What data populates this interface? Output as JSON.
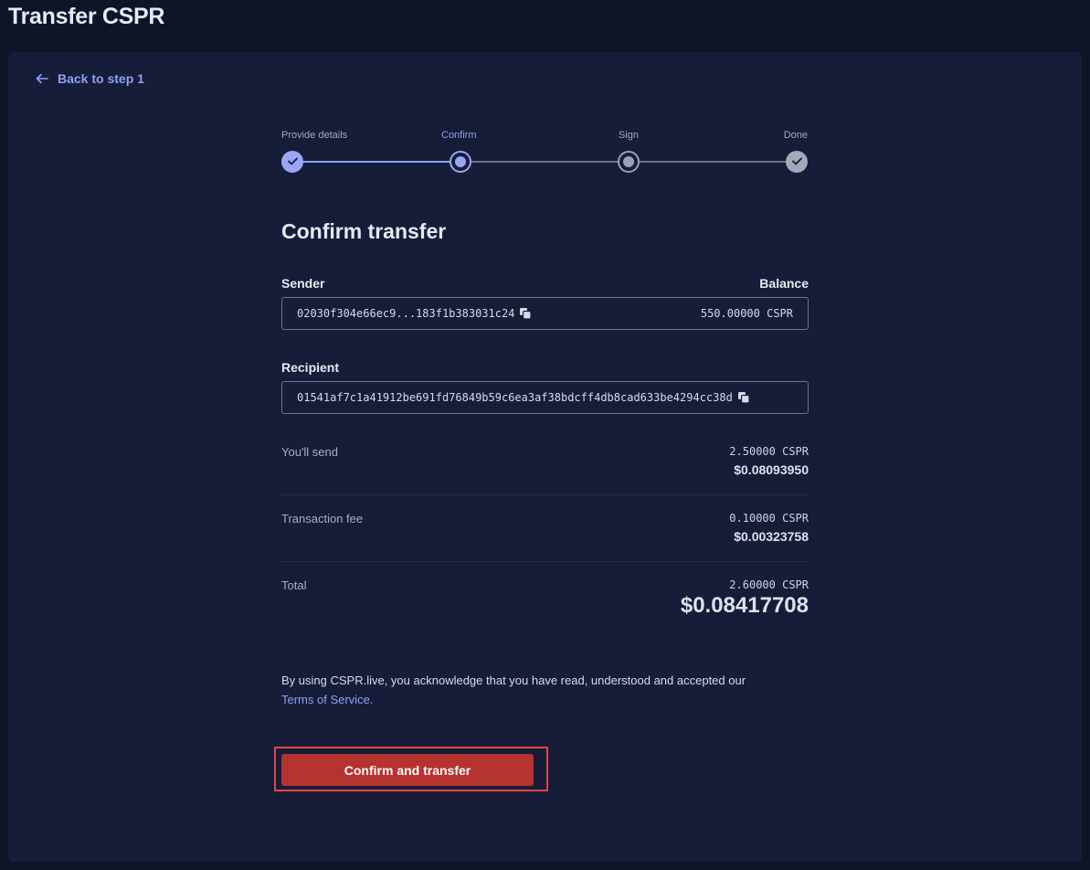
{
  "page": {
    "title": "Transfer CSPR"
  },
  "nav": {
    "back_label": "Back to step 1"
  },
  "stepper": {
    "steps": [
      {
        "label": "Provide details",
        "state": "done"
      },
      {
        "label": "Confirm",
        "state": "active"
      },
      {
        "label": "Sign",
        "state": "pending"
      },
      {
        "label": "Done",
        "state": "pending"
      }
    ]
  },
  "confirm": {
    "heading": "Confirm transfer",
    "sender_label": "Sender",
    "balance_label": "Balance",
    "sender_address": "02030f304e66ec9...183f1b383031c24",
    "balance_value": "550.00000 CSPR",
    "recipient_label": "Recipient",
    "recipient_address": "01541af7c1a41912be691fd76849b59c6ea3af38bdcff4db8cad633be4294cc38d",
    "send_label": "You'll send",
    "send_cspr": "2.50000 CSPR",
    "send_usd": "$0.08093950",
    "fee_label": "Transaction fee",
    "fee_cspr": "0.10000 CSPR",
    "fee_usd": "$0.00323758",
    "total_label": "Total",
    "total_cspr": "2.60000 CSPR",
    "total_usd": "$0.08417708"
  },
  "terms": {
    "text": "By using CSPR.live, you acknowledge that you have read, understood and accepted our",
    "link": "Terms of Service."
  },
  "actions": {
    "confirm_label": "Confirm and transfer"
  },
  "colors": {
    "accent": "#8fa0f5",
    "button": "#b5332f",
    "highlight": "#e14545",
    "panel": "#171c38"
  }
}
